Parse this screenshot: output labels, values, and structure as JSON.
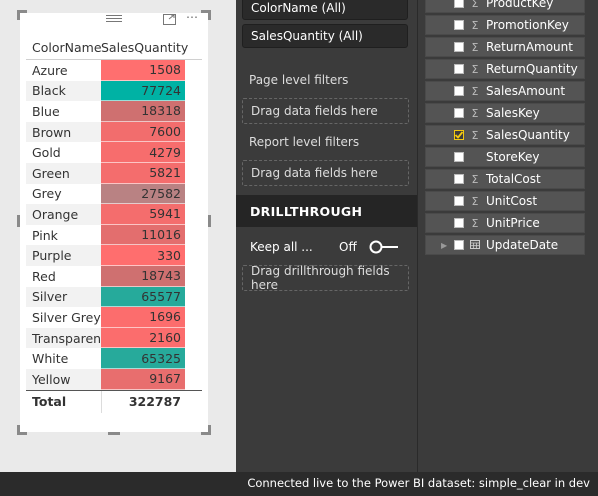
{
  "table": {
    "headers": [
      "ColorName",
      "SalesQuantity"
    ],
    "rows": [
      {
        "name": "Azure",
        "value": "1508",
        "color": "#ff6f6f"
      },
      {
        "name": "Black",
        "value": "77724",
        "color": "#00b2a4"
      },
      {
        "name": "Blue",
        "value": "18318",
        "color": "#cf7070"
      },
      {
        "name": "Brown",
        "value": "7600",
        "color": "#f26d6d"
      },
      {
        "name": "Gold",
        "value": "4279",
        "color": "#f76d6d"
      },
      {
        "name": "Green",
        "value": "5821",
        "color": "#f46d6d"
      },
      {
        "name": "Grey",
        "value": "27582",
        "color": "#b98283"
      },
      {
        "name": "Orange",
        "value": "5941",
        "color": "#f46d6d"
      },
      {
        "name": "Pink",
        "value": "11016",
        "color": "#e36e6e"
      },
      {
        "name": "Purple",
        "value": "330",
        "color": "#ff6e6e"
      },
      {
        "name": "Red",
        "value": "18743",
        "color": "#cf7070"
      },
      {
        "name": "Silver",
        "value": "65577",
        "color": "#26aa9b"
      },
      {
        "name": "Silver Grey",
        "value": "1696",
        "color": "#fc6d6d"
      },
      {
        "name": "Transparent",
        "value": "2160",
        "color": "#fb6d6d"
      },
      {
        "name": "White",
        "value": "65325",
        "color": "#27aa9b"
      },
      {
        "name": "Yellow",
        "value": "9167",
        "color": "#e86e6e"
      }
    ],
    "total_label": "Total",
    "total_value": "322787"
  },
  "filters": {
    "visual_filters": [
      "ColorName  (All)",
      "SalesQuantity  (All)"
    ],
    "page_level_label": "Page level filters",
    "report_level_label": "Report level filters",
    "drag_fields": "Drag data fields here",
    "drillthrough_header": "DRILLTHROUGH",
    "keep_all_label": "Keep all ...",
    "keep_all_value": "Off",
    "drag_drillthrough": "Drag drillthrough fields here"
  },
  "fields": [
    {
      "name": "ProductKey",
      "sigma": true,
      "checked": false,
      "partial": true
    },
    {
      "name": "PromotionKey",
      "sigma": true,
      "checked": false
    },
    {
      "name": "ReturnAmount",
      "sigma": true,
      "checked": false
    },
    {
      "name": "ReturnQuantity",
      "sigma": true,
      "checked": false
    },
    {
      "name": "SalesAmount",
      "sigma": true,
      "checked": false
    },
    {
      "name": "SalesKey",
      "sigma": true,
      "checked": false
    },
    {
      "name": "SalesQuantity",
      "sigma": true,
      "checked": true
    },
    {
      "name": "StoreKey",
      "sigma": false,
      "checked": false
    },
    {
      "name": "TotalCost",
      "sigma": true,
      "checked": false
    },
    {
      "name": "UnitCost",
      "sigma": true,
      "checked": false
    },
    {
      "name": "UnitPrice",
      "sigma": true,
      "checked": false
    },
    {
      "name": "UpdateDate",
      "sigma": false,
      "checked": false,
      "date": true,
      "expandable": true
    }
  ],
  "status": "Connected live to the Power BI dataset: simple_clear in dev",
  "colors": {
    "accent": "#f2c811",
    "teal": "#00b2a4",
    "red": "#ff6f6f"
  }
}
